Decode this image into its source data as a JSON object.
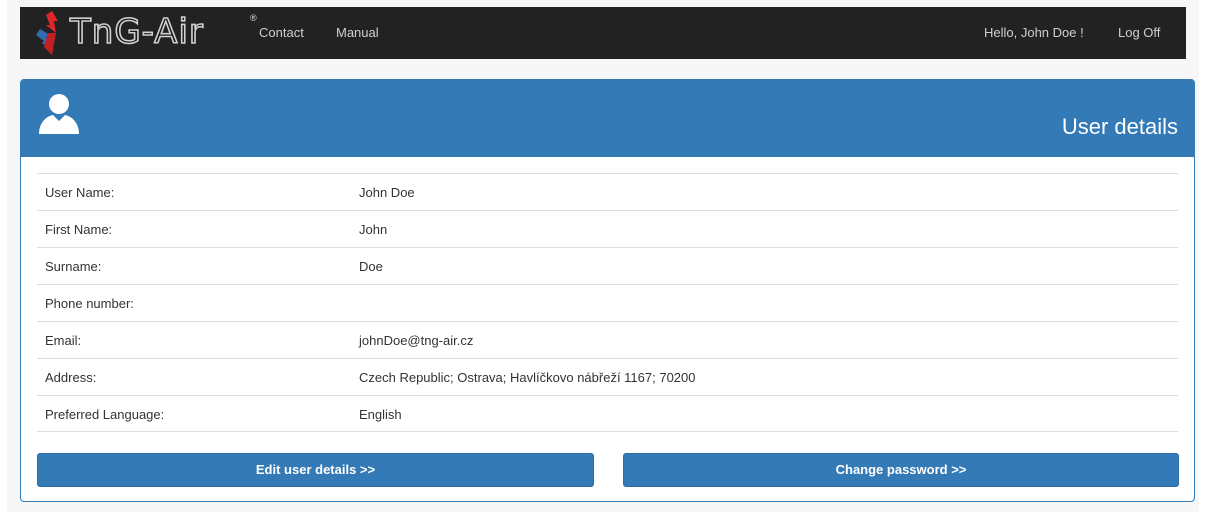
{
  "navbar": {
    "brand": "TnG-Air",
    "brand_mark": "®",
    "links": [
      "Contact",
      "Manual"
    ],
    "greeting": "Hello, John Doe !",
    "logoff": "Log Off"
  },
  "panel": {
    "title": "User details",
    "header_icon": "user-icon",
    "rows": [
      {
        "label": "User Name:",
        "value": "John Doe"
      },
      {
        "label": "First Name:",
        "value": "John"
      },
      {
        "label": "Surname:",
        "value": "Doe"
      },
      {
        "label": "Phone number:",
        "value": ""
      },
      {
        "label": "Email:",
        "value": "johnDoe@tng-air.cz"
      },
      {
        "label": "Address:",
        "value": "Czech Republic; Ostrava; Havlíčkovo nábřeží 1167; 70200"
      },
      {
        "label": "Preferred Language:",
        "value": "English"
      }
    ],
    "buttons": {
      "edit": "Edit user details >>",
      "change_password": "Change password >>"
    }
  },
  "colors": {
    "navbar": "#222222",
    "primary": "#337ab7",
    "page_background": "#f7f7f7"
  }
}
